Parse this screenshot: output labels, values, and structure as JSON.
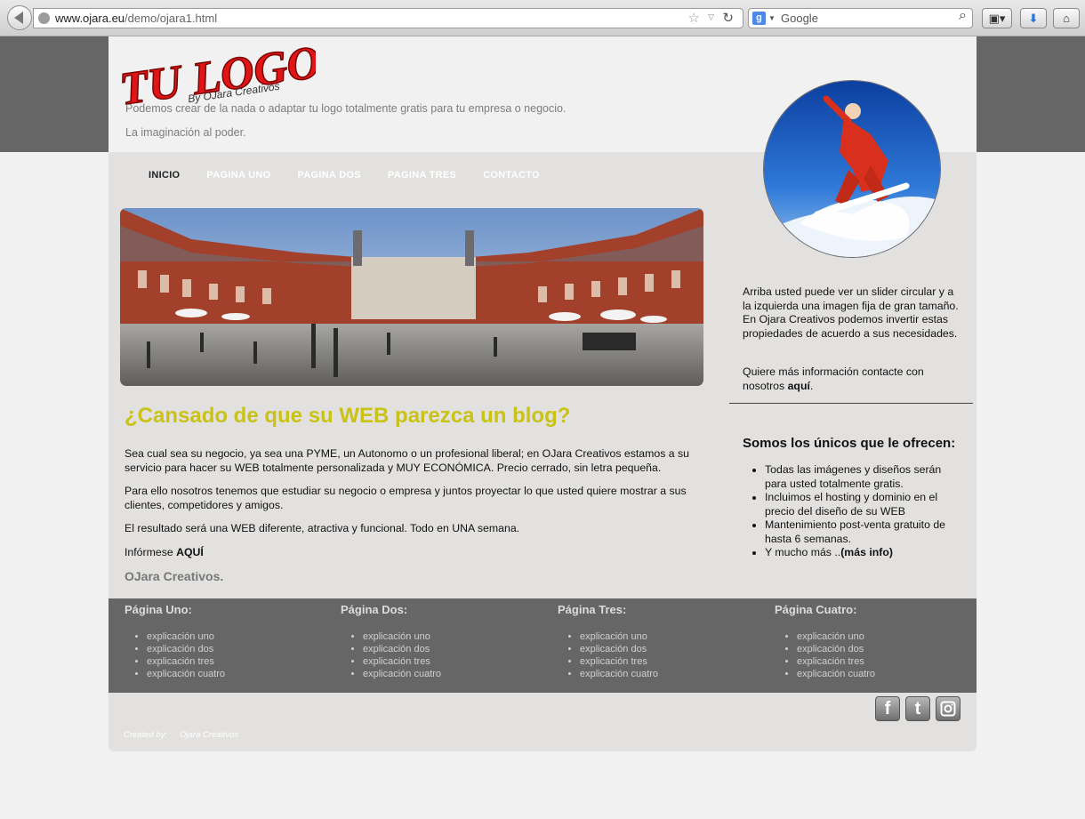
{
  "browser": {
    "url_host": "www.ojara.eu",
    "url_path": "/demo/ojara1.html",
    "search_placeholder": "Google",
    "search_engine_letter": "g"
  },
  "logo": {
    "main": "TU LOGO",
    "sub": "By OJara Creativos"
  },
  "header": {
    "tagline1": "Podemos crear de la nada o adaptar tu logo totalmente gratis para tu empresa o negocio.",
    "tagline2": "La imaginación al poder."
  },
  "nav": {
    "items": [
      "INICIO",
      "PAGINA UNO",
      "PAGINA DOS",
      "PAGINA TRES",
      "CONTACTO"
    ]
  },
  "main": {
    "headline": "¿Cansado de que su WEB parezca un blog?",
    "p1": "Sea cual sea su negocio, ya sea una PYME, un Autonomo o un profesional liberal; en OJara Creativos estamos a su servicio para hacer su WEB totalmente personalizada y MUY ECONÓMICA. Precio cerrado, sin letra pequeña.",
    "p2": "Para ello nosotros tenemos que estudiar su negocio o empresa y juntos proyectar lo que usted quiere mostrar a sus clientes, competidores y amigos.",
    "p3": "El resultado será una WEB diferente, atractiva y funcional. Todo en UNA semana.",
    "info_prefix": "Infórmese ",
    "info_link": "AQUÍ",
    "brand": "OJara Creativos."
  },
  "sidebar": {
    "text1": "Arriba usted puede ver un slider circular y a la izquierda una imagen fija de gran tamaño. En Ojara Creativos podemos invertir estas propiedades de acuerdo a sus necesidades.",
    "text2_prefix": "Quiere más información contacte con nosotros ",
    "text2_link": "aquí",
    "text2_suffix": ".",
    "title": "Somos los únicos que le ofrecen:",
    "list": [
      "Todas las imágenes y diseños serán para usted totalmente gratis.",
      "Incluimos el hosting y dominio en el precio del diseño de su WEB",
      "Mantenimiento post-venta gratuito de hasta 6 semanas."
    ],
    "list_last_prefix": "Y mucho más ..",
    "list_last_link": "(más info)"
  },
  "footer": {
    "columns": [
      {
        "title": "Página Uno:",
        "items": [
          "explicación uno",
          "explicación dos",
          "explicación tres",
          "explicación cuatro"
        ]
      },
      {
        "title": "Página Dos:",
        "items": [
          "explicación uno",
          "explicación dos",
          "explicación tres",
          "explicación cuatro"
        ]
      },
      {
        "title": "Página Tres:",
        "items": [
          "explicación uno",
          "explicación dos",
          "explicación tres",
          "explicación cuatro"
        ]
      },
      {
        "title": "Página Cuatro:",
        "items": [
          "explicación uno",
          "explicación dos",
          "explicación tres",
          "explicación cuatro"
        ]
      }
    ],
    "credit_label": "Created by:",
    "credit_name": "Ojara Creativos",
    "social": {
      "facebook": "f",
      "twitter": "t"
    }
  },
  "colors": {
    "headline": "#c9c217",
    "footer_bg": "#666666",
    "page_bg": "#e2e1df",
    "logo_red": "#e01616"
  }
}
